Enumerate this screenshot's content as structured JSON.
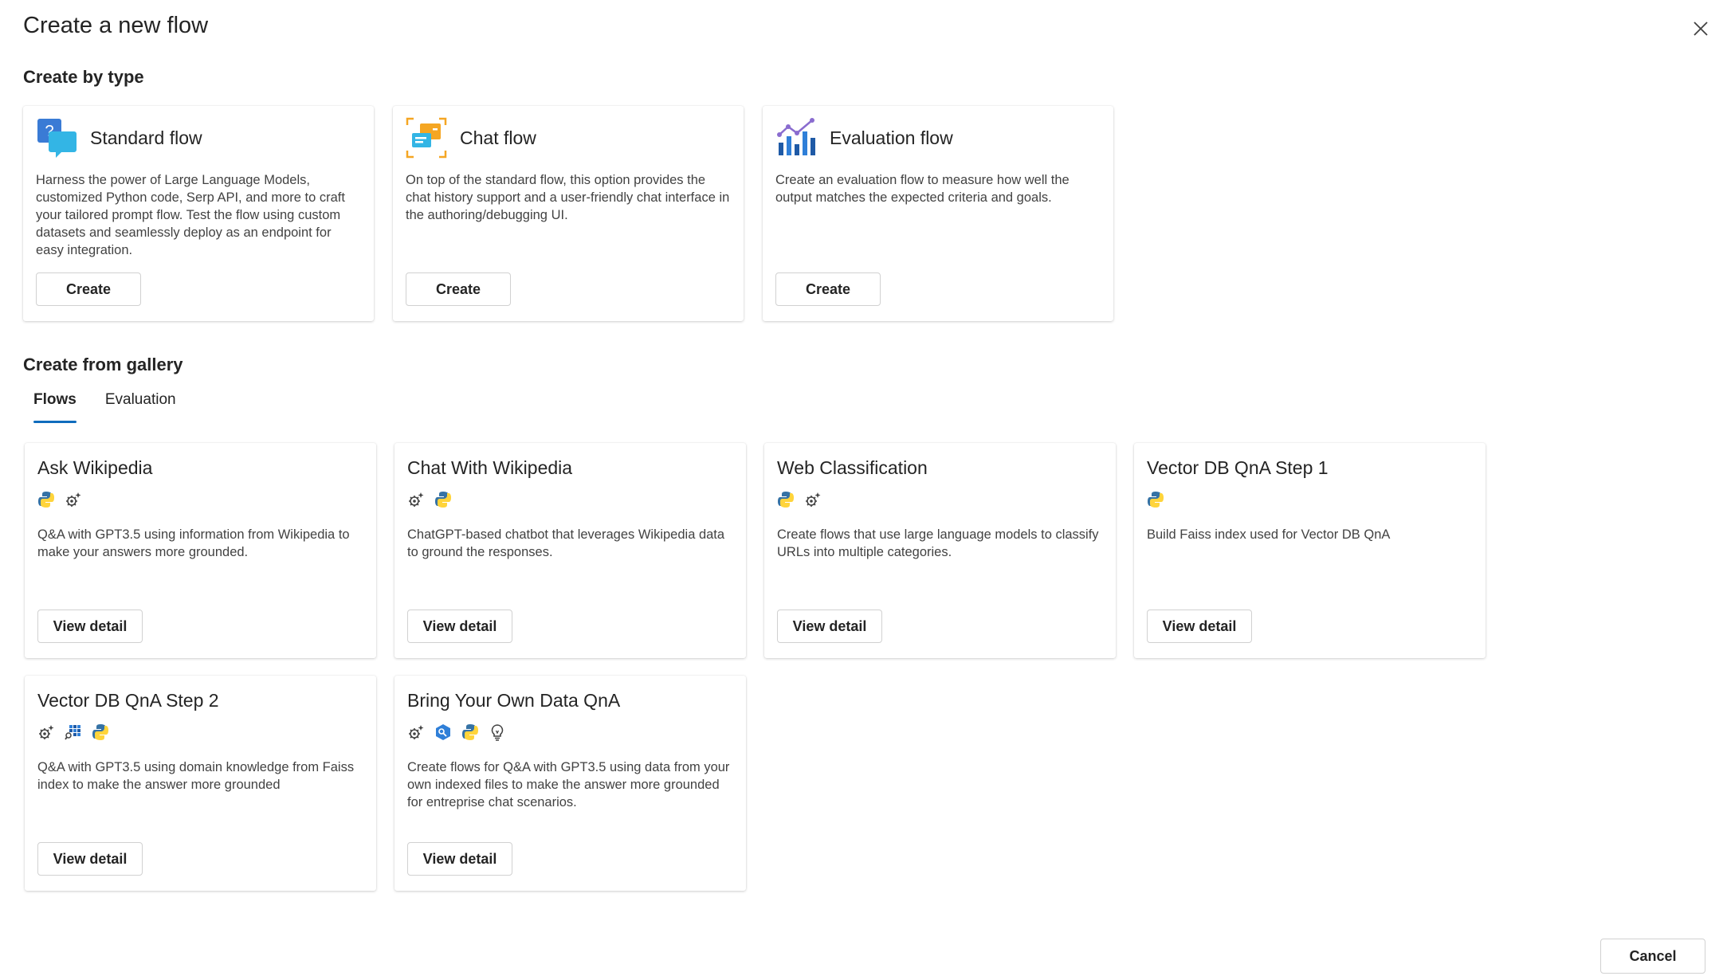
{
  "dialog": {
    "title": "Create a new flow",
    "cancel_label": "Cancel"
  },
  "create_by_type": {
    "heading": "Create by type",
    "cards": [
      {
        "title": "Standard flow",
        "icon": "standard-flow-icon",
        "description": "Harness the power of Large Language Models, customized Python code, Serp API, and more to craft your tailored prompt flow. Test the flow using custom datasets and seamlessly deploy as an endpoint for easy integration.",
        "button": "Create"
      },
      {
        "title": "Chat flow",
        "icon": "chat-flow-icon",
        "description": "On top of the standard flow, this option provides the chat history support and a user-friendly chat interface in the authoring/debugging UI.",
        "button": "Create"
      },
      {
        "title": "Evaluation flow",
        "icon": "evaluation-flow-icon",
        "description": "Create an evaluation flow to measure how well the output matches the expected criteria and goals.",
        "button": "Create"
      }
    ]
  },
  "gallery": {
    "heading": "Create from gallery",
    "tabs": [
      {
        "label": "Flows",
        "active": true
      },
      {
        "label": "Evaluation",
        "active": false
      }
    ],
    "cards": [
      {
        "title": "Ask Wikipedia",
        "icons": [
          "python-icon",
          "llm-gear-icon"
        ],
        "description": "Q&A with GPT3.5 using information from Wikipedia to make your answers more grounded.",
        "button": "View detail"
      },
      {
        "title": "Chat With Wikipedia",
        "icons": [
          "llm-gear-icon",
          "python-icon"
        ],
        "description": "ChatGPT-based chatbot that leverages Wikipedia data to ground the responses.",
        "button": "View detail"
      },
      {
        "title": "Web Classification",
        "icons": [
          "python-icon",
          "llm-gear-icon"
        ],
        "description": "Create flows that use large language models to classify URLs into multiple categories.",
        "button": "View detail"
      },
      {
        "title": "Vector DB QnA Step 1",
        "icons": [
          "python-icon"
        ],
        "description": "Build Faiss index used for Vector DB QnA",
        "button": "View detail"
      },
      {
        "title": "Vector DB QnA Step 2",
        "icons": [
          "llm-gear-icon",
          "vector-search-icon",
          "python-icon"
        ],
        "description": "Q&A with GPT3.5 using domain knowledge from Faiss index to make the answer more grounded",
        "button": "View detail"
      },
      {
        "title": "Bring Your Own Data QnA",
        "icons": [
          "llm-gear-icon",
          "vector-lookup-icon",
          "python-icon",
          "lightbulb-icon"
        ],
        "description": "Create flows for Q&A with GPT3.5 using data from your own indexed files to make the answer more grounded for entreprise chat scenarios.",
        "button": "View detail"
      }
    ]
  },
  "colors": {
    "accent": "#0f6cbd",
    "text": "#242424",
    "secondary_text": "#424242",
    "border": "#d1d1d1"
  }
}
